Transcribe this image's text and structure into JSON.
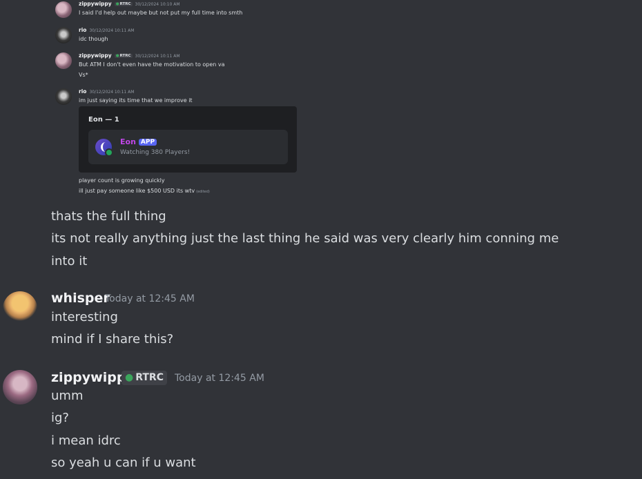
{
  "embedded_screenshot": {
    "messages": [
      {
        "user": "zippywippy",
        "tag": "RTRC",
        "time": "30/12/2024 10:10 AM",
        "lines": [
          "I said I'd help out maybe but not put my full time into smth"
        ]
      },
      {
        "user": "rio",
        "time": "30/12/2024 10:11 AM",
        "lines": [
          "idc though"
        ]
      },
      {
        "user": "zippywippy",
        "tag": "RTRC",
        "time": "30/12/2024 10:11 AM",
        "lines": [
          "But ATM I don't even have the motivation to open va",
          "Vs*"
        ]
      },
      {
        "user": "rio",
        "time": "30/12/2024 10:11 AM",
        "lines": [
          "im just saying its time that we improve it"
        ]
      }
    ],
    "embed": {
      "title": "Eon — 1",
      "app_name": "Eon",
      "app_badge": "APP",
      "status": "Watching 380 Players!"
    },
    "after_embed": [
      "player count is growing quickly",
      "ill just pay someone like $500 USD its wtv"
    ],
    "edited_label": "(edited)"
  },
  "chat": {
    "continuation": [
      "thats the full thing",
      "its not really anything just the last thing he said was very clearly him conning me",
      "into it"
    ],
    "messages": [
      {
        "user": "whisper",
        "time": "Today at 12:45 AM",
        "lines": [
          "interesting",
          "mind if I share this?"
        ]
      },
      {
        "user": "zippywippy",
        "tag": "RTRC",
        "time": "Today at 12:45 AM",
        "lines": [
          "umm",
          "ig?",
          "i mean idrc",
          "so yeah u can if u want"
        ]
      }
    ]
  },
  "colors": {
    "background": "#313338",
    "text": "#dbdee1",
    "username": "#f2f3f5",
    "timestamp": "#949ba4",
    "embed_bg": "#1e1f22",
    "app_name": "#c046e8",
    "app_badge": "#5865f2",
    "online": "#23a55a"
  },
  "icons": [
    "avatar-zippywippy",
    "avatar-rio",
    "avatar-whisper",
    "leaf-icon",
    "eon-app-icon"
  ]
}
